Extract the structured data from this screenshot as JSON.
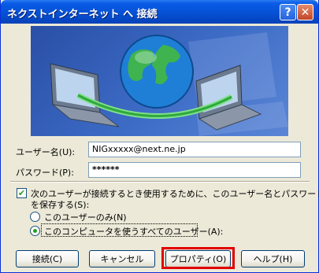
{
  "window": {
    "title": "ネクストインターネット へ 接続"
  },
  "titlebar": {
    "help_label": "?",
    "close_label": "✕"
  },
  "form": {
    "username_label": "ユーザー名(U):",
    "username_value": "NIGxxxxx@next.ne.jp",
    "password_label": "パスワード(P):",
    "password_value": "******"
  },
  "save_option": {
    "checkbox_label_line1": "次のユーザーが接続するとき使用するために、このユーザー名とパスワード",
    "checkbox_label_line2": "を保存する(S):",
    "checked": true,
    "radio_me_only": "このユーザーのみ(N)",
    "radio_anyone": "このコンピュータを使うすべてのユーザー(A):",
    "selected": "anyone"
  },
  "buttons": {
    "connect": "接続(C)",
    "cancel": "キャンセル",
    "properties": "プロパティ(O)",
    "help": "ヘルプ(H)"
  },
  "colors": {
    "titlebar": "#0653d8",
    "highlight": "#e20000",
    "dialog_bg": "#ece9d8"
  },
  "banner": {
    "icon": "globe-with-two-laptops"
  }
}
